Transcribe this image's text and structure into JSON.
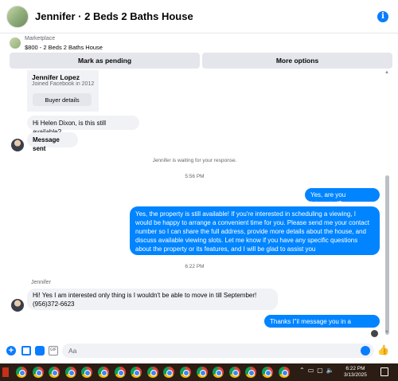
{
  "header": {
    "title": "Jennifer · 2 Beds 2 Baths House",
    "info_icon_label": "i"
  },
  "marketplace": {
    "label": "Marketplace",
    "listing": "$800 - 2 Beds 2 Baths House",
    "mark_pending_label": "Mark as pending",
    "more_options_label": "More options"
  },
  "profile_card": {
    "name": "Jennifer Lopez",
    "joined": "Joined Facebook in 2012",
    "buyer_details_label": "Buyer details"
  },
  "messages": [
    {
      "from": "buyer",
      "text": "Hi Helen Dixon, is this still available?"
    },
    {
      "from": "buyer",
      "text": "Message sent"
    },
    {
      "from": "me",
      "text": "Yes, are you interested?"
    },
    {
      "from": "me",
      "text": "Yes, the property is still available! If you're interested in scheduling a viewing, I would be happy to arrange a convenient time for you. Please send me your contact number so I can share the full address, provide more details about the house, and discuss available viewing slots. Let me know if you have any specific questions about the property or its features, and I will be glad to assist you"
    },
    {
      "from": "buyer",
      "text": "Hi! Yes I am interested only thing is I wouldn't be able to move in till September! (956)372-6623"
    },
    {
      "from": "me",
      "text": "Thanks I\"il message you in a moment"
    }
  ],
  "status": {
    "waiting": "Jennifer is waiting for your response.",
    "timestamp1": "5:56 PM",
    "timestamp2": "6:22 PM",
    "sender_name": "Jennifer"
  },
  "composer": {
    "placeholder": "Aa",
    "gif_label": "GIF"
  },
  "taskbar": {
    "time": "6:22 PM",
    "date": "3/13/2025",
    "chrome_count": 17
  },
  "colors": {
    "accent": "#0084ff",
    "bubble_in": "#f0f2f5",
    "taskbar": "#2b1d14"
  }
}
